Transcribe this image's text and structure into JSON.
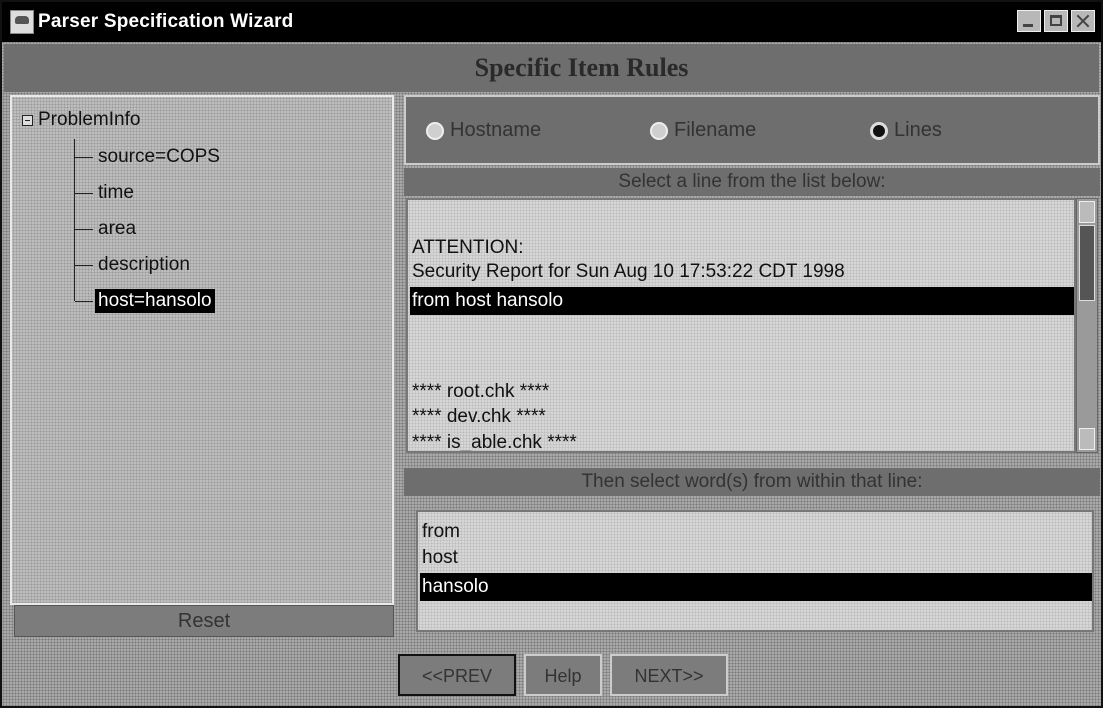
{
  "window": {
    "title": "Parser Specification Wizard"
  },
  "header": {
    "title": "Specific Item Rules"
  },
  "tree": {
    "root": "ProblemInfo",
    "items": [
      {
        "label": "source=COPS"
      },
      {
        "label": "time"
      },
      {
        "label": "area"
      },
      {
        "label": "description"
      },
      {
        "label": "host=hansolo"
      }
    ],
    "selected": "host=hansolo"
  },
  "reset_label": "Reset",
  "radio": {
    "options": [
      "Hostname",
      "Filename",
      "Lines"
    ],
    "selected": "Lines"
  },
  "lines_section": {
    "prompt": "Select a line from the list below:",
    "lines": [
      "",
      "ATTENTION:",
      "Security Report for Sun Aug 10 17:53:22 CDT 1998",
      "from host hansolo",
      "",
      "",
      "**** root.chk ****",
      "**** dev.chk ****",
      "**** is_able.chk ****"
    ],
    "selected": "from host hansolo"
  },
  "words_section": {
    "prompt": "Then select word(s) from within that line:",
    "words": [
      "from",
      "host",
      "hansolo"
    ],
    "selected": "hansolo"
  },
  "nav": {
    "prev": "<<PREV",
    "help": "Help",
    "next": "NEXT>>"
  }
}
